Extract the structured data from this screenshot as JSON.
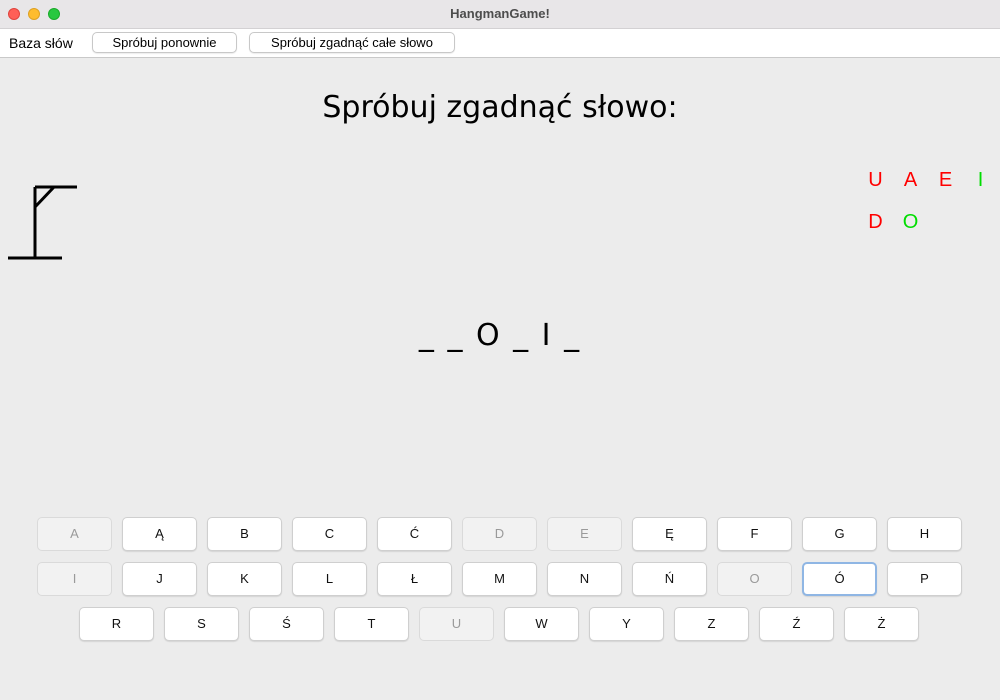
{
  "window": {
    "title": "HangmanGame!"
  },
  "toolbar": {
    "menu_label": "Baza słów",
    "retry_label": "Spróbuj ponownie",
    "guess_word_label": "Spróbuj zgadnąć całe słowo"
  },
  "game": {
    "heading": "Spróbuj zgadnąć słowo:",
    "word_display": "_ _ O _ I _",
    "used_letters": [
      {
        "letter": "U",
        "status": "wrong"
      },
      {
        "letter": "A",
        "status": "wrong"
      },
      {
        "letter": "E",
        "status": "wrong"
      },
      {
        "letter": "I",
        "status": "correct"
      },
      {
        "letter": "D",
        "status": "wrong"
      },
      {
        "letter": "O",
        "status": "correct"
      }
    ],
    "hangman_stage": 3
  },
  "colors": {
    "wrong": "#ff0000",
    "correct": "#00dd00"
  },
  "keyboard": {
    "rows": [
      [
        {
          "letter": "A",
          "state": "disabled"
        },
        {
          "letter": "Ą",
          "state": "enabled"
        },
        {
          "letter": "B",
          "state": "enabled"
        },
        {
          "letter": "C",
          "state": "enabled"
        },
        {
          "letter": "Ć",
          "state": "enabled"
        },
        {
          "letter": "D",
          "state": "disabled"
        },
        {
          "letter": "E",
          "state": "disabled"
        },
        {
          "letter": "Ę",
          "state": "enabled"
        },
        {
          "letter": "F",
          "state": "enabled"
        },
        {
          "letter": "G",
          "state": "enabled"
        },
        {
          "letter": "H",
          "state": "enabled"
        }
      ],
      [
        {
          "letter": "I",
          "state": "disabled"
        },
        {
          "letter": "J",
          "state": "enabled"
        },
        {
          "letter": "K",
          "state": "enabled"
        },
        {
          "letter": "L",
          "state": "enabled"
        },
        {
          "letter": "Ł",
          "state": "enabled"
        },
        {
          "letter": "M",
          "state": "enabled"
        },
        {
          "letter": "N",
          "state": "enabled"
        },
        {
          "letter": "Ń",
          "state": "enabled"
        },
        {
          "letter": "O",
          "state": "disabled"
        },
        {
          "letter": "Ó",
          "state": "focused"
        },
        {
          "letter": "P",
          "state": "enabled"
        }
      ],
      [
        {
          "letter": "R",
          "state": "enabled"
        },
        {
          "letter": "S",
          "state": "enabled"
        },
        {
          "letter": "Ś",
          "state": "enabled"
        },
        {
          "letter": "T",
          "state": "enabled"
        },
        {
          "letter": "U",
          "state": "disabled"
        },
        {
          "letter": "W",
          "state": "enabled"
        },
        {
          "letter": "Y",
          "state": "enabled"
        },
        {
          "letter": "Z",
          "state": "enabled"
        },
        {
          "letter": "Ź",
          "state": "enabled"
        },
        {
          "letter": "Ż",
          "state": "enabled"
        }
      ]
    ]
  }
}
